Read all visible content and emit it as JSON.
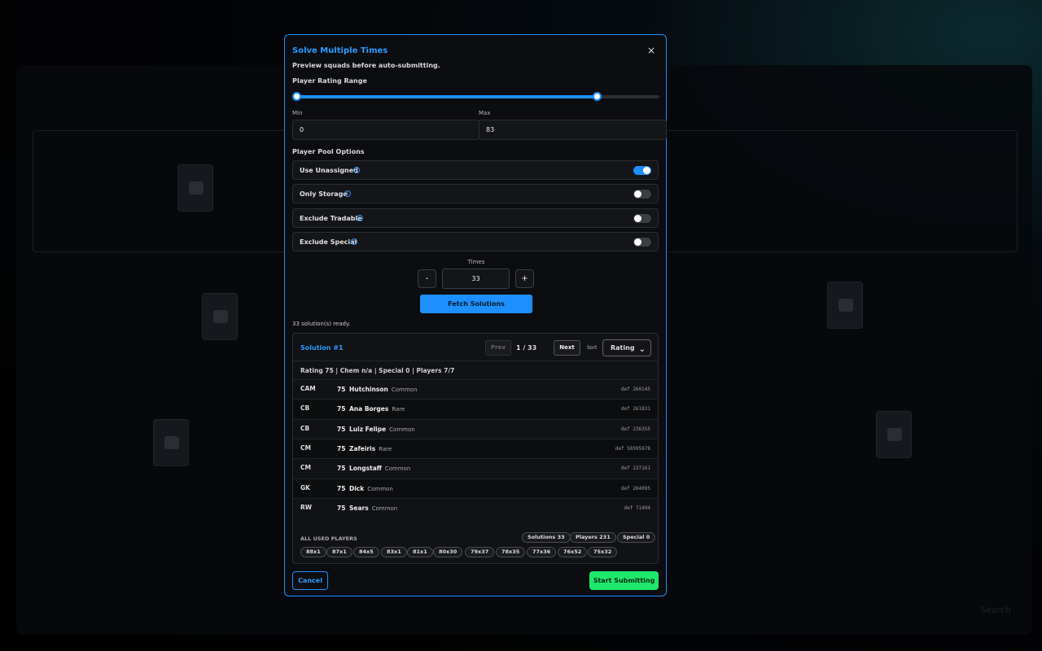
{
  "modal": {
    "title": "Solve Multiple Times",
    "close": "×",
    "subtitle": "Preview squads before auto-submitting.",
    "rating_range_label": "Player Rating Range",
    "slider": {
      "min_fraction": 0,
      "max_fraction": 0.828
    },
    "min_label": "Min",
    "max_label": "Max",
    "min_value": "0",
    "max_value": "83",
    "pool_label": "Player Pool Options",
    "options": [
      {
        "label": "Use Unassigned",
        "on": true
      },
      {
        "label": "Only Storage",
        "on": false
      },
      {
        "label": "Exclude Tradable",
        "on": false
      },
      {
        "label": "Exclude Special",
        "on": false
      }
    ],
    "info_glyph": "i",
    "times_label": "Times",
    "times_value": "33",
    "minus": "-",
    "plus": "+",
    "fetch_label": "Fetch Solutions",
    "ready_text": "33 solution(s) ready.",
    "cancel_label": "Cancel",
    "submit_label": "Start Submitting"
  },
  "solution": {
    "title": "Solution #1",
    "prev": "Prev",
    "page": "1 / 33",
    "next": "Next",
    "sort_label": "Sort",
    "sort_value": "Rating",
    "summary": "Rating 75 | Chem n/a | Special 0 | Players 7/7",
    "players": [
      {
        "pos": "CAM",
        "rating": "75",
        "name": "Hutchinson",
        "rarity": "Common",
        "def": "def 260145"
      },
      {
        "pos": "CB",
        "rating": "75",
        "name": "Ana Borges",
        "rarity": "Rare",
        "def": "def 261831"
      },
      {
        "pos": "CB",
        "rating": "75",
        "name": "Luiz Felipe",
        "rarity": "Common",
        "def": "def 236355"
      },
      {
        "pos": "CM",
        "rating": "75",
        "name": "Zafeiris",
        "rarity": "Rare",
        "def": "def 50595978"
      },
      {
        "pos": "CM",
        "rating": "75",
        "name": "Longstaff",
        "rarity": "Common",
        "def": "def 237161"
      },
      {
        "pos": "GK",
        "rating": "75",
        "name": "Dick",
        "rarity": "Common",
        "def": "def 264095"
      },
      {
        "pos": "RW",
        "rating": "75",
        "name": "Sears",
        "rarity": "Common",
        "def": "def 71494"
      }
    ],
    "used_label": "ALL USED PLAYERS",
    "stats": [
      "Solutions 33",
      "Players 231",
      "Special 0"
    ],
    "chips": [
      "88x1",
      "87x1",
      "84x5",
      "83x1",
      "81x1",
      "80x30",
      "79x37",
      "78x35",
      "77x36",
      "76x52",
      "75x32"
    ]
  },
  "background": {
    "corner_text": "Search"
  },
  "colors": {
    "accent": "#1e8fff",
    "submit": "#1ee86c",
    "panel": "#0c0d10"
  }
}
